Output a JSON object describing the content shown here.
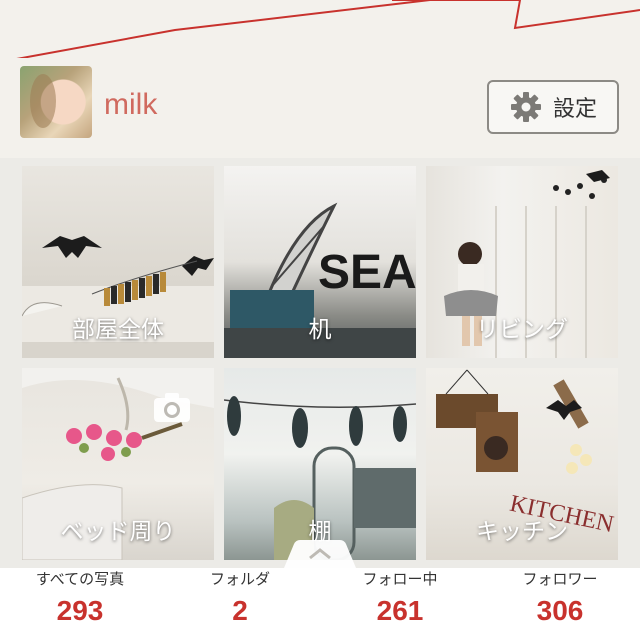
{
  "header": {
    "accent_color": "#c8322d"
  },
  "profile": {
    "username": "milk",
    "settings_label": "設定",
    "settings_icon": "gear-icon"
  },
  "folders": [
    {
      "label": "部屋全体"
    },
    {
      "label": "机"
    },
    {
      "label": "リビング"
    },
    {
      "label": "ベッド周り"
    },
    {
      "label": "棚"
    },
    {
      "label": "キッチン"
    }
  ],
  "stats": {
    "photos": {
      "label": "すべての写真",
      "value": "293"
    },
    "folders": {
      "label": "フォルダ",
      "value": "2"
    },
    "following": {
      "label": "フォロー中",
      "value": "261"
    },
    "followers": {
      "label": "フォロワー",
      "value": "306"
    }
  }
}
